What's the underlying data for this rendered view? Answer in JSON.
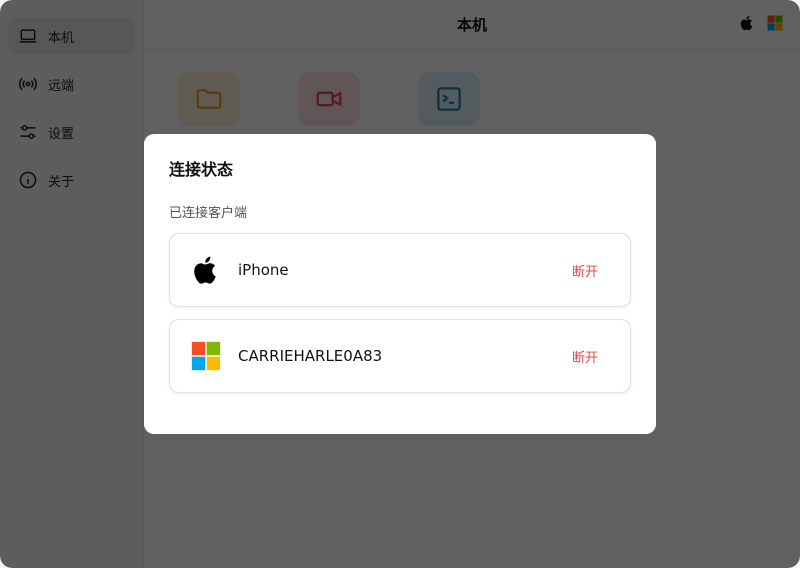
{
  "sidebar": {
    "items": [
      {
        "label": "本机",
        "icon": "laptop-icon",
        "active": true
      },
      {
        "label": "远端",
        "icon": "broadcast-icon",
        "active": false
      },
      {
        "label": "设置",
        "icon": "sliders-icon",
        "active": false
      },
      {
        "label": "关于",
        "icon": "info-icon",
        "active": false
      }
    ]
  },
  "header": {
    "title": "本机",
    "icons": [
      "apple-icon",
      "windows-icon"
    ]
  },
  "tiles": [
    {
      "icon": "folder-icon",
      "color": "#e0a31b"
    },
    {
      "icon": "video-camera-icon",
      "color": "#e5484d"
    },
    {
      "icon": "terminal-icon",
      "color": "#1f7fb0"
    }
  ],
  "dialog": {
    "title": "连接状态",
    "subtitle": "已连接客户端",
    "clients": [
      {
        "name": "iPhone",
        "icon": "apple-icon",
        "action": "断开"
      },
      {
        "name": "CARRIEHARLE0A83",
        "icon": "windows-icon",
        "action": "断开"
      }
    ]
  },
  "colors": {
    "accent_danger": "#e54848",
    "overlay": "rgba(0,0,0,0.62)"
  }
}
